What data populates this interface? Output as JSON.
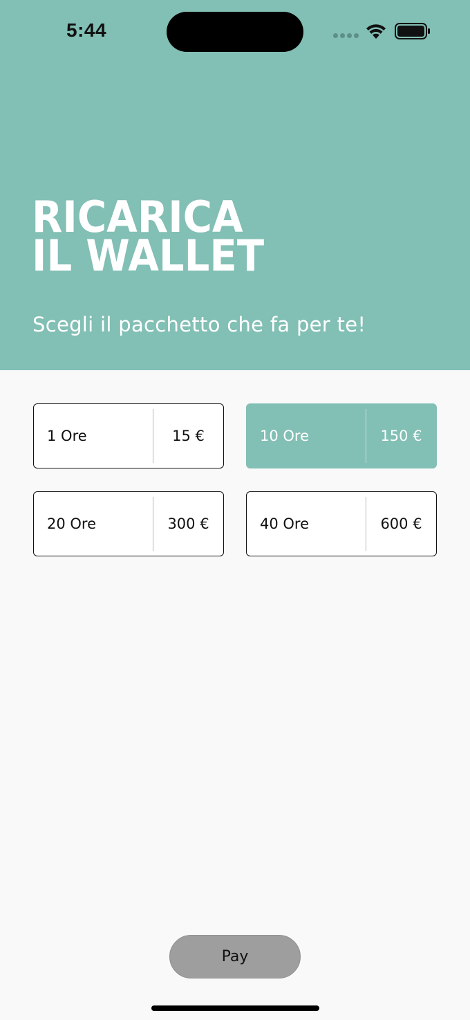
{
  "status_bar": {
    "time": "5:44",
    "icons": [
      "signal-dots-icon",
      "wifi-icon",
      "battery-icon"
    ]
  },
  "header": {
    "title_line1": "RICARICA",
    "title_line2": "IL WALLET",
    "subtitle": "Scegli il pacchetto che fa per te!",
    "background_color": "#82bfb4"
  },
  "packages": [
    {
      "hours": "1 Ore",
      "price": "15 €",
      "selected": false
    },
    {
      "hours": "10 Ore",
      "price": "150 €",
      "selected": true
    },
    {
      "hours": "20 Ore",
      "price": "300 €",
      "selected": false
    },
    {
      "hours": "40 Ore",
      "price": "600 €",
      "selected": false
    }
  ],
  "pay_button": {
    "label": "Pay",
    "color": "#9e9e9e"
  },
  "colors": {
    "accent": "#82bfb4",
    "background": "#f9f9f9"
  }
}
